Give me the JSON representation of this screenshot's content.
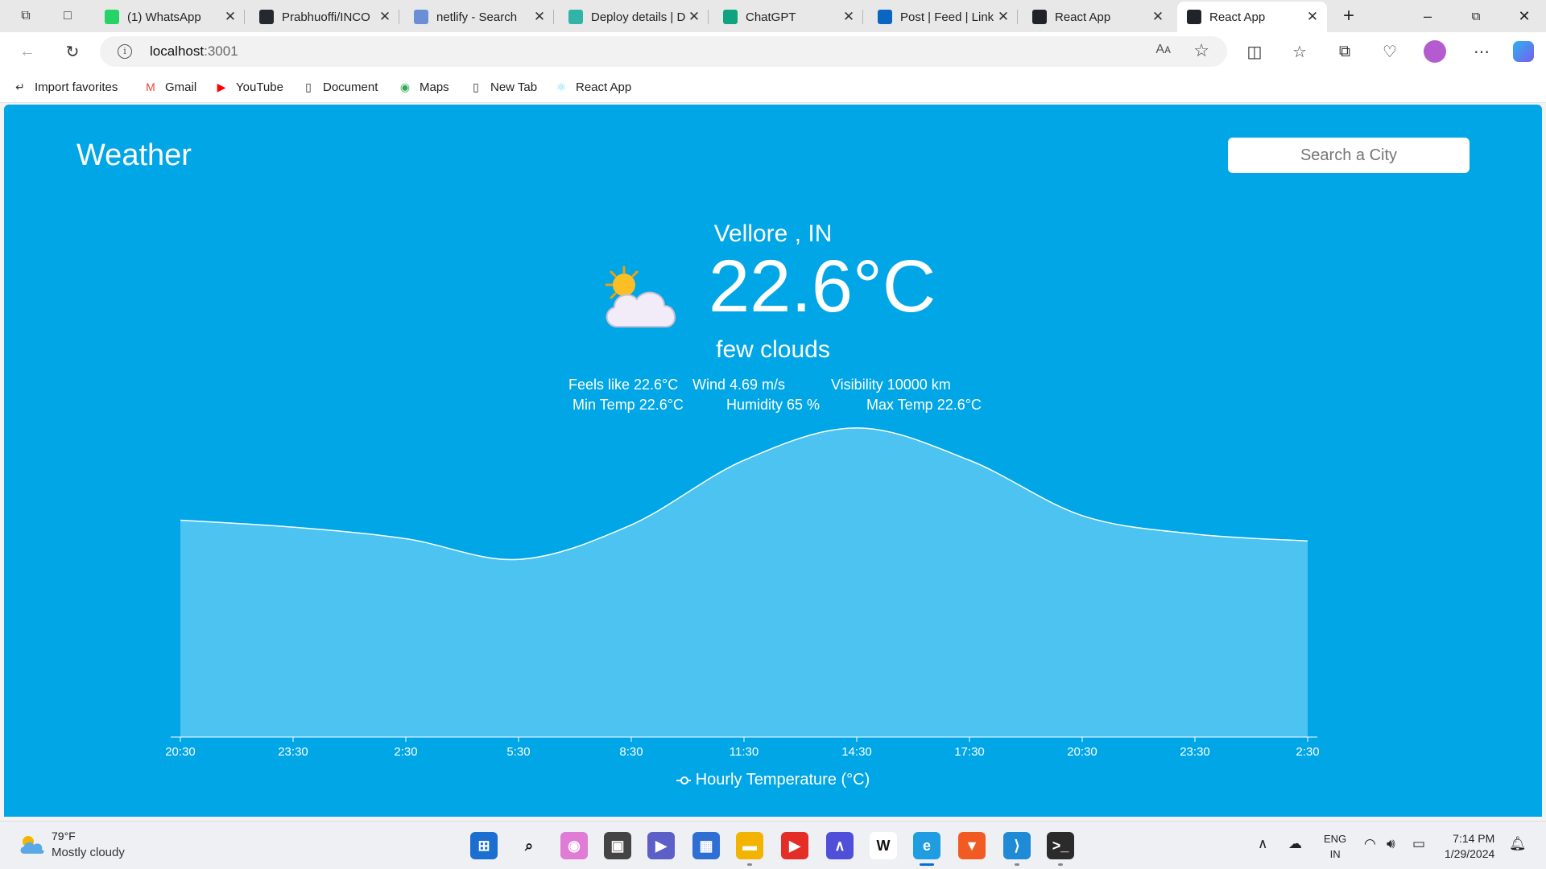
{
  "browser": {
    "tabs": [
      {
        "title": "(1) WhatsApp",
        "icon": "whatsapp-icon",
        "color": "#25d366"
      },
      {
        "title": "Prabhuoffi/INCO",
        "icon": "github-icon",
        "color": "#24292f"
      },
      {
        "title": "netlify - Search",
        "icon": "search-icon",
        "color": "#6b8fd6"
      },
      {
        "title": "Deploy details | D",
        "icon": "netlify-icon",
        "color": "#32b3a8"
      },
      {
        "title": "ChatGPT",
        "icon": "chatgpt-icon",
        "color": "#10a37f"
      },
      {
        "title": "Post | Feed | Link",
        "icon": "linkedin-icon",
        "color": "#0a66c2"
      },
      {
        "title": "React App",
        "icon": "react-icon",
        "color": "#20232a"
      },
      {
        "title": "React App",
        "icon": "react-icon",
        "color": "#20232a",
        "active": true
      }
    ],
    "address": {
      "host": "localhost",
      "port": ":3001"
    },
    "read_aloud_label": "Aᴀ",
    "bookmarks": [
      {
        "label": "Import favorites",
        "icon": "import-icon"
      },
      {
        "label": "Gmail",
        "icon": "gmail-icon"
      },
      {
        "label": "YouTube",
        "icon": "youtube-icon"
      },
      {
        "label": "Document",
        "icon": "document-icon"
      },
      {
        "label": "Maps",
        "icon": "maps-icon"
      },
      {
        "label": "New Tab",
        "icon": "page-icon"
      },
      {
        "label": "React App",
        "icon": "react-icon"
      }
    ]
  },
  "app": {
    "title": "Weather",
    "search_placeholder": "Search a City",
    "city": "Vellore , IN",
    "temperature": "22.6°C",
    "description": "few clouds",
    "weather_icon": "partly-cloudy-icon",
    "stats": {
      "feels_like": "Feels like 22.6°C",
      "wind": "Wind 4.69 m/s",
      "visibility": "Visibility 10000 km",
      "min_temp": "Min Temp 22.6°C",
      "humidity": "Humidity 65 %",
      "max_temp": "Max Temp 22.6°C"
    },
    "accent": "#00a6e6"
  },
  "chart_data": {
    "type": "area",
    "x": [
      "20:30",
      "23:30",
      "2:30",
      "5:30",
      "8:30",
      "11:30",
      "14:30",
      "17:30",
      "20:30",
      "23:30",
      "2:30"
    ],
    "series": [
      {
        "name": "Hourly Temperature (°C)",
        "values": [
          24.4,
          24.1,
          23.6,
          22.7,
          24.2,
          27.0,
          28.4,
          27.0,
          24.6,
          23.8,
          23.5
        ]
      }
    ],
    "ylim": [
      15,
      30
    ],
    "grid": false,
    "legend": "bottom-center",
    "fill_color": "#4cc3f0",
    "line_color": "#ffffff"
  },
  "taskbar": {
    "weather_temp": "79°F",
    "weather_condition": "Mostly cloudy",
    "apps": [
      {
        "name": "windows-start-icon",
        "label": "⊞",
        "bg": "#1b6fd1"
      },
      {
        "name": "search-icon",
        "label": "⌕",
        "bg": "#eef0f3"
      },
      {
        "name": "copilot-icon",
        "label": "◉",
        "bg": "#e07bd6"
      },
      {
        "name": "task-view-icon",
        "label": "▣",
        "bg": "#444444"
      },
      {
        "name": "meet-icon",
        "label": "▶",
        "bg": "#5b5fc7"
      },
      {
        "name": "store-icon",
        "label": "▦",
        "bg": "#2f6fd4"
      },
      {
        "name": "file-explorer-icon",
        "label": "▬",
        "bg": "#f2b400"
      },
      {
        "name": "youtube-icon",
        "label": "▶",
        "bg": "#e52d27"
      },
      {
        "name": "vs-icon",
        "label": "∧",
        "bg": "#4f4fd9"
      },
      {
        "name": "wikipedia-icon",
        "label": "W",
        "bg": "#ffffff"
      },
      {
        "name": "edge-icon",
        "label": "e",
        "bg": "#1f9de0"
      },
      {
        "name": "brave-icon",
        "label": "▼",
        "bg": "#f15a22"
      },
      {
        "name": "vscode-icon",
        "label": "⟩",
        "bg": "#1f8ad6"
      },
      {
        "name": "terminal-icon",
        "label": ">_",
        "bg": "#2b2b2b"
      }
    ],
    "lang_line1": "ENG",
    "lang_line2": "IN",
    "time": "7:14 PM",
    "date": "1/29/2024"
  }
}
